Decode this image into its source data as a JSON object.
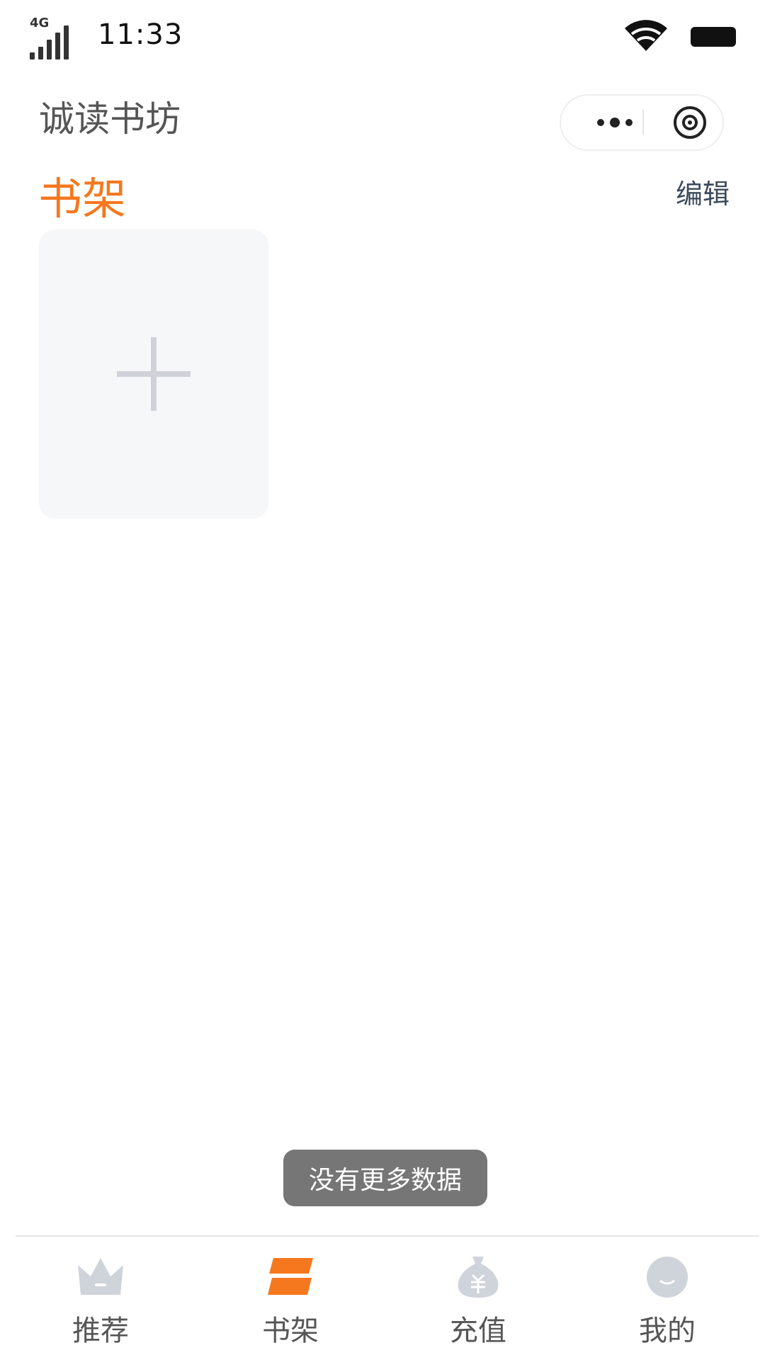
{
  "status_bar": {
    "network": "4G",
    "time": "11:33",
    "icons": [
      "signal-icon",
      "wifi-icon",
      "battery-icon"
    ]
  },
  "header": {
    "app_title": "诚读书坊",
    "capsule_icons": [
      "more-icon",
      "close-icon"
    ]
  },
  "shelf": {
    "title": "书架",
    "edit_label": "编辑",
    "add_icon": "plus-icon"
  },
  "toast": {
    "text": "没有更多数据"
  },
  "tabbar": {
    "tabs": [
      {
        "label": "推荐",
        "icon": "crown-icon",
        "active": false
      },
      {
        "label": "书架",
        "icon": "bookshelf-icon",
        "active": true
      },
      {
        "label": "充值",
        "icon": "money-bag-icon",
        "active": false
      },
      {
        "label": "我的",
        "icon": "profile-icon",
        "active": false
      }
    ]
  },
  "colors": {
    "accent": "#f5781e",
    "inactive_icon": "#cfd3da",
    "toast_bg": "#767676",
    "card_bg": "#f6f7f9"
  }
}
